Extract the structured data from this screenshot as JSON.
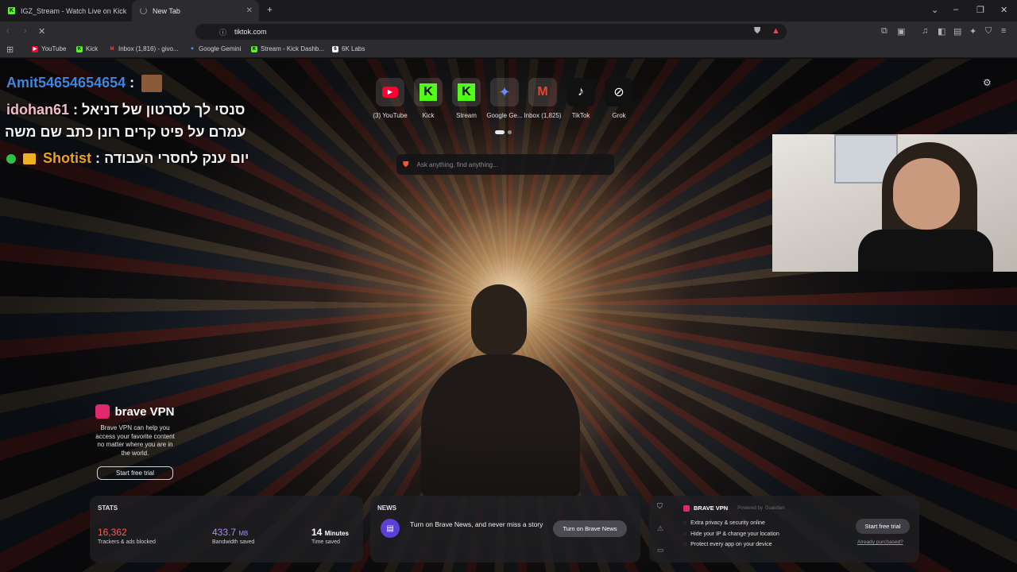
{
  "tabs": [
    {
      "label": "IGZ_Stream - Watch Live on Kick",
      "active": false
    },
    {
      "label": "New Tab",
      "active": true
    }
  ],
  "address": {
    "url": "tiktok.com"
  },
  "bookmarks": [
    "YouTube",
    "Kick",
    "Inbox (1,816) - givo...",
    "Google Gemini",
    "Stream - Kick Dashb...",
    "6K Labs"
  ],
  "chat": [
    {
      "user": "Amit54654654654",
      "sep": ":",
      "message": ""
    },
    {
      "user": "idohan61",
      "sep": ":",
      "message": "סנסי לך לסרטון של דניאל"
    },
    {
      "user": "",
      "sep": "",
      "message": "עמרם על פיט קרים רונן כתב שם משה"
    },
    {
      "user": "Shotist",
      "sep": ":",
      "message": "יום ענק לחסרי העבודה"
    }
  ],
  "top_sites": [
    {
      "label": "(3) YouTube",
      "icon": "youtube-icon",
      "color": "#ff0033"
    },
    {
      "label": "Kick",
      "icon": "kick-icon",
      "color": "#53fc18"
    },
    {
      "label": "Stream",
      "icon": "kick-icon",
      "color": "#53fc18"
    },
    {
      "label": "Google Ge...",
      "icon": "gemini-icon",
      "color": "#6a8cff"
    },
    {
      "label": "Inbox (1,825)",
      "icon": "gmail-icon",
      "color": "#ea4335"
    },
    {
      "label": "TikTok",
      "icon": "tiktok-icon",
      "color": "#ffffff"
    },
    {
      "label": "Grok",
      "icon": "grok-icon",
      "color": "#ffffff"
    }
  ],
  "search": {
    "placeholder": "Ask anything, find anything..."
  },
  "vpn_promo": {
    "title": "brave VPN",
    "text": "Brave VPN can help you access your favorite content no matter where you are in the world.",
    "button": "Start free trial"
  },
  "stats": {
    "title": "STATS",
    "trackers_value": "16,362",
    "trackers_label": "Trackers & ads blocked",
    "bandwidth_value": "433.7",
    "bandwidth_unit": "MB",
    "bandwidth_label": "Bandwidth saved",
    "time_value": "14",
    "time_unit": "Minutes",
    "time_label": "Time saved"
  },
  "news": {
    "title": "NEWS",
    "text": "Turn on Brave News, and never miss a story",
    "button": "Turn on Brave News"
  },
  "vpn_card": {
    "title": "BRAVE VPN",
    "powered": "Powered by",
    "provider": "Guardian",
    "features": [
      "Extra privacy & security online",
      "Hide your IP & change your location",
      "Protect every app on your device"
    ],
    "button": "Start free trial",
    "link": "Already purchased?"
  },
  "colors": {
    "accent_kick": "#53fc18",
    "chat_blue": "#3f86e0",
    "chat_orange": "#f0a020",
    "stats_red": "#ff5a4e",
    "stats_purple": "#a78bfa"
  }
}
